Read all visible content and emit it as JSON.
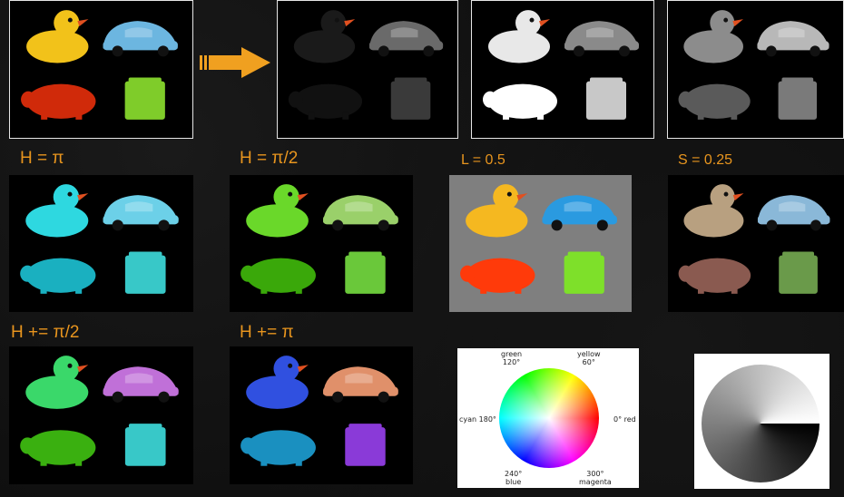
{
  "labels": {
    "h_pi": "H = π",
    "h_pi2": "H = π/2",
    "l_half": "L = 0.5",
    "s_quarter": "S = 0.25",
    "h_add_pi2": "H += π/2",
    "h_add_pi": "H += π"
  },
  "hue_wheel": {
    "green": "green",
    "green_deg": "120°",
    "yellow": "yellow",
    "yellow_deg": "60°",
    "cyan": "cyan 180°",
    "red": "0° red",
    "blue_deg": "240°",
    "blue": "blue",
    "magenta_deg": "300°",
    "magenta": "magenta"
  },
  "colors": {
    "accent_label": "#e8951e",
    "arrow": "#f0a020"
  },
  "panels": [
    {
      "id": "original",
      "duck": "#f2c21a",
      "car": "#6cb6e0",
      "pig": "#d02a0a",
      "box": "#7fcc2a"
    },
    {
      "id": "hue-channel",
      "duck": "#1a1a1a",
      "car": "#6a6a6a",
      "pig": "#111111",
      "box": "#3a3a3a"
    },
    {
      "id": "saturation-channel",
      "duck": "#e8e8e8",
      "car": "#8a8a8a",
      "pig": "#ffffff",
      "box": "#c8c8c8"
    },
    {
      "id": "lightness-channel",
      "duck": "#8c8c8c",
      "car": "#b8b8b8",
      "pig": "#5a5a5a",
      "box": "#7a7a7a"
    },
    {
      "id": "h-pi",
      "duck": "#2ed8e0",
      "car": "#6cd0e8",
      "pig": "#1ab0c0",
      "box": "#38c8c8"
    },
    {
      "id": "h-pi2",
      "duck": "#6ad82a",
      "car": "#9ad06a",
      "pig": "#3aa80a",
      "box": "#6ac83a"
    },
    {
      "id": "l-half",
      "duck": "#f5b820",
      "car": "#2a9ae0",
      "pig": "#ff3a0a",
      "box": "#7ee02a"
    },
    {
      "id": "s-quarter",
      "duck": "#b8a080",
      "car": "#8ab8d8",
      "pig": "#8a5a50",
      "box": "#6a9a4a"
    },
    {
      "id": "h-add-pi2",
      "duck": "#3ad86a",
      "car": "#c070d8",
      "pig": "#3ab010",
      "box": "#38c8c8"
    },
    {
      "id": "h-add-pi",
      "duck": "#3050e0",
      "car": "#e0906a",
      "pig": "#1a90c0",
      "box": "#8a3ad8"
    }
  ]
}
